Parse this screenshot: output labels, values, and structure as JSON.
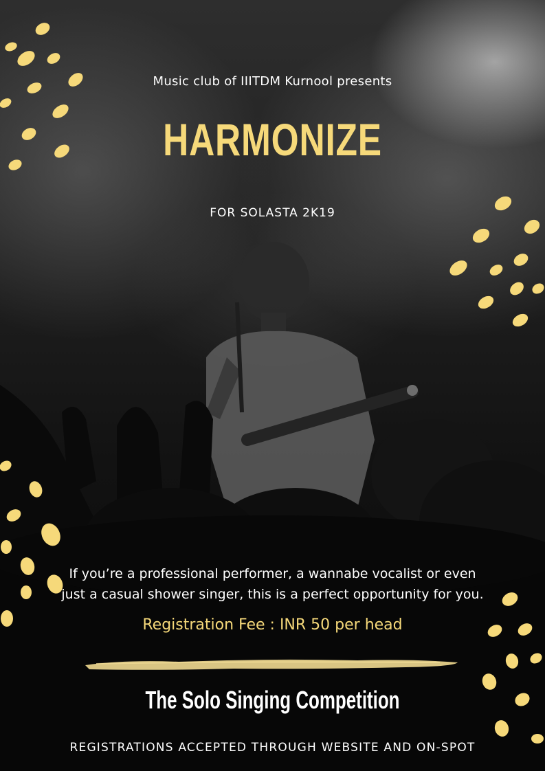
{
  "poster": {
    "presenter": "Music club of IIITDM Kurnool presents",
    "title": "HARMONIZE",
    "subtitle": "FOR SOLASTA 2K19",
    "description_line1": "If you’re a professional performer, a wannabe vocalist or even",
    "description_line2": "just a casual shower singer, this is a perfect opportunity for you.",
    "fee": "Registration Fee : INR 50 per head",
    "competition": "The Solo Singing Competition",
    "footer": "REGISTRATIONS ACCEPTED THROUGH WEBSITE AND ON-SPOT"
  },
  "colors": {
    "accent_gold": "#f6d97a",
    "text_white": "#ffffff",
    "background_dark": "#0b0b0b"
  }
}
